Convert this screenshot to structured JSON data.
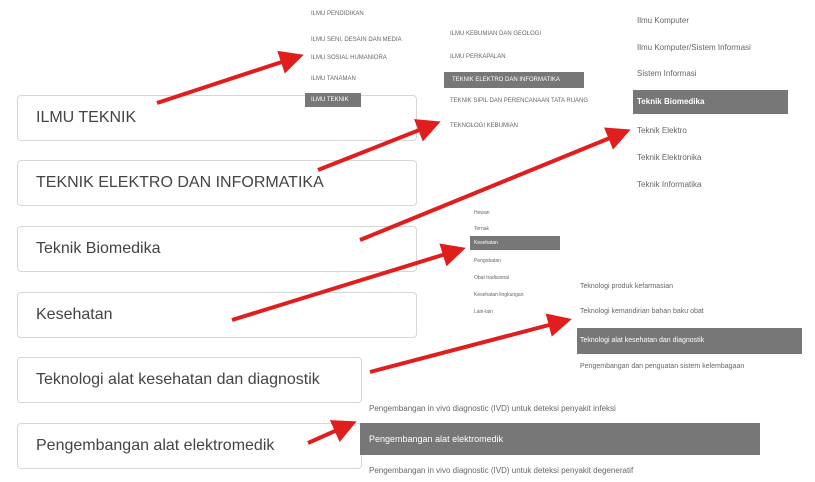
{
  "boxes": [
    {
      "label": "ILMU TEKNIK"
    },
    {
      "label": "TEKNIK ELEKTRO DAN INFORMATIKA"
    },
    {
      "label": "Teknik Biomedika"
    },
    {
      "label": "Kesehatan"
    },
    {
      "label": "Teknologi alat kesehatan dan diagnostik"
    },
    {
      "label": "Pengembangan alat elektromedik"
    }
  ],
  "menu1": {
    "items": [
      "ILMU PENDIDIKAN",
      "ILMU SENI, DESAIN DAN MEDIA",
      "ILMU SOSIAL HUMANIORA",
      "ILMU TANAMAN",
      "ILMU TEKNIK"
    ],
    "selected": 4
  },
  "menu2": {
    "items": [
      "ILMU KEBUMIAN DAN GEOLOGI",
      "ILMU PERKAPALAN",
      "TEKNIK ELEKTRO DAN INFORMATIKA",
      "TEKNIK SIPIL DAN PERENCANAAN TATA RUANG",
      "TEKNOLOGI KEBUMIAN"
    ],
    "selected": 2
  },
  "menu3": {
    "items": [
      "Ilmu Komputer",
      "Ilmu Komputer/Sistem Informasi",
      "Sistem Informasi",
      "Teknik Biomedika",
      "Teknik Elektro",
      "Teknik Elektronika",
      "Teknik Informatika"
    ],
    "selected": 3
  },
  "menu4": {
    "items": [
      "Hewan",
      "Ternak",
      "Kesehatan",
      "Pengobatan",
      "Obat tradisional",
      "Kesehatan lingkungan",
      "Lain-lain"
    ],
    "selected": 2
  },
  "menu5": {
    "items": [
      "Teknologi produk kefarmasian",
      "Teknologi kemandirian bahan baku obat",
      "Teknologi alat kesehatan dan diagnostik",
      "Pengembangan dan penguatan sistem kelembagaan"
    ],
    "selected": 2
  },
  "menu6": {
    "items": [
      "Pengembangan in vivo diagnostic (IVD) untuk deteksi penyakit infeksi",
      "Pengembangan alat elektromedik",
      "Pengembangan in vivo diagnostic (IVD) untuk deteksi penyakit degeneratif"
    ],
    "selected": 1
  },
  "colors": {
    "arrow": "#e01e1e",
    "selected_bg": "#777777",
    "box_border": "#d7d7d7"
  }
}
